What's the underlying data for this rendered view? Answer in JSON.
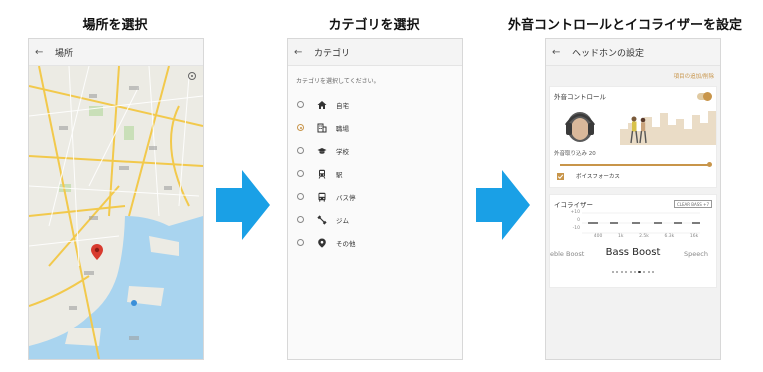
{
  "steps": {
    "step1": "場所を選択",
    "step2": "カテゴリを選択",
    "step3": "外音コントロールとイコライザーを設定"
  },
  "map_screen": {
    "title": "場所"
  },
  "category_screen": {
    "title": "カテゴリ",
    "hint": "カテゴリを選択してください。",
    "items": [
      {
        "label": "自宅",
        "icon": "home-icon",
        "selected": false
      },
      {
        "label": "職場",
        "icon": "office-building-icon",
        "selected": true
      },
      {
        "label": "学校",
        "icon": "graduation-cap-icon",
        "selected": false
      },
      {
        "label": "駅",
        "icon": "train-icon",
        "selected": false
      },
      {
        "label": "バス停",
        "icon": "bus-icon",
        "selected": false
      },
      {
        "label": "ジム",
        "icon": "dumbbell-icon",
        "selected": false
      },
      {
        "label": "その他",
        "icon": "location-pin-icon",
        "selected": false
      }
    ]
  },
  "headphones_screen": {
    "title": "ヘッドホンの設定",
    "add_remove_link": "項目の追加/削除",
    "ambient": {
      "title": "外音コントロール",
      "level_label": "外音取り込み 20",
      "level_value": 20,
      "level_max": 20,
      "voice_focus_label": "ボイスフォーカス",
      "voice_focus_checked": true
    },
    "equalizer": {
      "title": "イコライザー",
      "clear_bass_button": "CLEAR BASS +7",
      "y_ticks": [
        "+10",
        "0",
        "-10"
      ],
      "bands": [
        "400",
        "1k",
        "2.5k",
        "6.3k",
        "16k"
      ],
      "preset_prev": "eble Boost",
      "preset_current": "Bass Boost",
      "preset_next": "Speech",
      "page_count": 10,
      "page_index": 6
    }
  },
  "colors": {
    "accent": "#c8954a",
    "arrow": "#1aa0e6",
    "water": "#a9d4ef"
  }
}
